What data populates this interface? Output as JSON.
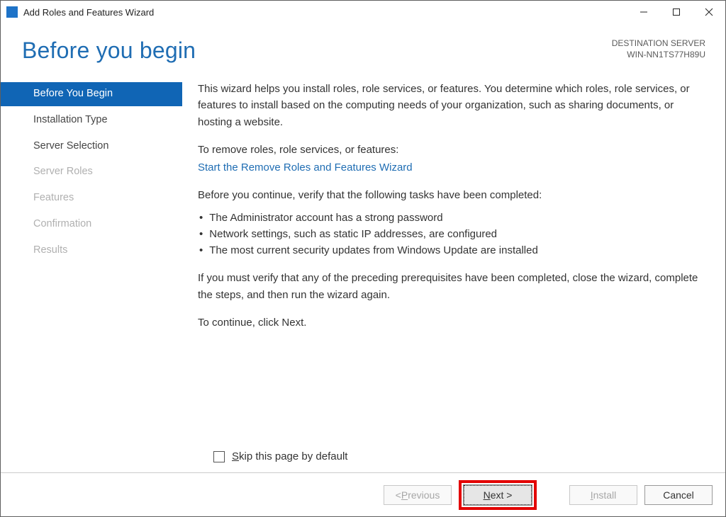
{
  "window": {
    "title": "Add Roles and Features Wizard"
  },
  "header": {
    "heading": "Before you begin",
    "dest_label": "DESTINATION SERVER",
    "dest_value": "WIN-NN1TS77H89U"
  },
  "sidebar": {
    "items": [
      {
        "label": "Before You Begin",
        "state": "active"
      },
      {
        "label": "Installation Type",
        "state": "enabled"
      },
      {
        "label": "Server Selection",
        "state": "enabled"
      },
      {
        "label": "Server Roles",
        "state": "disabled"
      },
      {
        "label": "Features",
        "state": "disabled"
      },
      {
        "label": "Confirmation",
        "state": "disabled"
      },
      {
        "label": "Results",
        "state": "disabled"
      }
    ]
  },
  "content": {
    "intro": "This wizard helps you install roles, role services, or features. You determine which roles, role services, or features to install based on the computing needs of your organization, such as sharing documents, or hosting a website.",
    "remove_lead": "To remove roles, role services, or features:",
    "remove_link": "Start the Remove Roles and Features Wizard",
    "verify_lead": "Before you continue, verify that the following tasks have been completed:",
    "bullets": [
      "The Administrator account has a strong password",
      "Network settings, such as static IP addresses, are configured",
      "The most current security updates from Windows Update are installed"
    ],
    "verify_tail": "If you must verify that any of the preceding prerequisites have been completed, close the wizard, complete the steps, and then run the wizard again.",
    "continue_text": "To continue, click Next."
  },
  "skip": {
    "label_pre": "S",
    "label_post": "kip this page by default",
    "checked": false
  },
  "footer": {
    "previous_pre": "< ",
    "previous_ul": "P",
    "previous_post": "revious",
    "next_ul": "N",
    "next_post": "ext >",
    "install_ul": "I",
    "install_post": "nstall",
    "cancel": "Cancel"
  }
}
